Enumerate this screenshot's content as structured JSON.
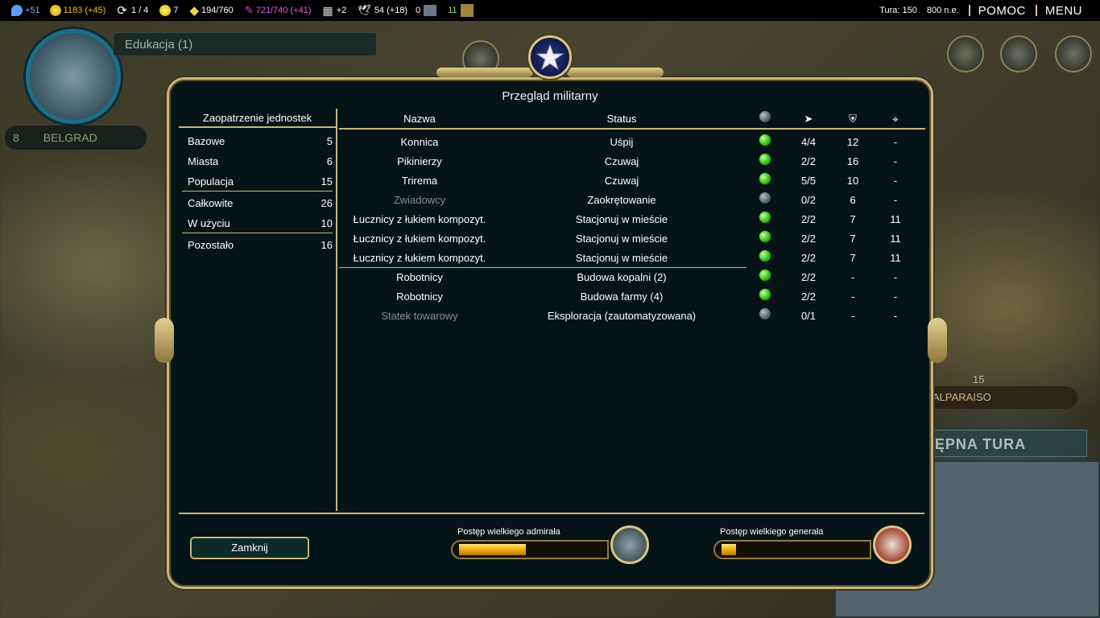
{
  "topbar": {
    "science": "+51",
    "gold": "1183 (+45)",
    "trade_routes": "1 / 4",
    "happiness": "7",
    "golden_age": "194/760",
    "culture": "721/740 (+41)",
    "tourism": "+2",
    "faith": "54 (+18)",
    "spies": "0",
    "strategic": "11",
    "turn": "Tura: 150",
    "year": "800 n.e.",
    "help": "POMOC",
    "menu": "MENU",
    "colors": {
      "science": "#5aa0ff",
      "gold": "#f2c300",
      "culture": "#e03be0"
    }
  },
  "background": {
    "education_label": "Edukacja (1)",
    "city_size": "8",
    "city_name": "BELGRAD",
    "right_city_name": "ALPARAISO",
    "right_city_defense": "15",
    "next_turn": "NASTĘPNA TURA"
  },
  "dialog": {
    "title": "Przegląd militarny",
    "supply": {
      "header": "Zaopatrzenie jednostek",
      "rows": [
        {
          "label": "Bazowe",
          "value": "5"
        },
        {
          "label": "Miasta",
          "value": "6"
        },
        {
          "label": "Populacja",
          "value": "15"
        },
        {
          "label": "Całkowite",
          "value": "26"
        },
        {
          "label": "W użyciu",
          "value": "10"
        },
        {
          "label": "Pozostało",
          "value": "16"
        }
      ]
    },
    "units": {
      "headers": {
        "name": "Nazwa",
        "status": "Status"
      },
      "header_icons": [
        "status-dot-icon",
        "movement-icon",
        "strength-icon",
        "ranged-icon"
      ],
      "rows": [
        {
          "name": "Konnica",
          "status": "Uśpij",
          "active": true,
          "moves": "4/4",
          "strength": "12",
          "ranged": "-"
        },
        {
          "name": "Pikinierzy",
          "status": "Czuwaj",
          "active": true,
          "moves": "2/2",
          "strength": "16",
          "ranged": "-"
        },
        {
          "name": "Trirema",
          "status": "Czuwaj",
          "active": true,
          "moves": "5/5",
          "strength": "10",
          "ranged": "-"
        },
        {
          "name": "Zwiadowcy",
          "status": "Zaokrętowanie",
          "active": false,
          "moves": "0/2",
          "strength": "6",
          "ranged": "-"
        },
        {
          "name": "Łucznicy z łukiem kompozyt.",
          "status": "Stacjonuj w mieście",
          "active": true,
          "moves": "2/2",
          "strength": "7",
          "ranged": "11"
        },
        {
          "name": "Łucznicy z łukiem kompozyt.",
          "status": "Stacjonuj w mieście",
          "active": true,
          "moves": "2/2",
          "strength": "7",
          "ranged": "11"
        },
        {
          "name": "Łucznicy z łukiem kompozyt.",
          "status": "Stacjonuj w mieście",
          "active": true,
          "moves": "2/2",
          "strength": "7",
          "ranged": "11"
        },
        {
          "name": "Robotnicy",
          "status": "Budowa kopalni (2)",
          "active": true,
          "moves": "2/2",
          "strength": "-",
          "ranged": "-"
        },
        {
          "name": "Robotnicy",
          "status": "Budowa farmy (4)",
          "active": true,
          "moves": "2/2",
          "strength": "-",
          "ranged": "-"
        },
        {
          "name": "Statek towarowy",
          "status": "Eksploracja (zautomatyzowana)",
          "active": false,
          "moves": "0/1",
          "strength": "-",
          "ranged": "-"
        }
      ]
    },
    "close_label": "Zamknij",
    "admiral": {
      "label": "Postęp wielkiego admirała",
      "progress": 0.47
    },
    "general": {
      "label": "Postęp wielkiego generała",
      "progress": 0.1
    }
  }
}
